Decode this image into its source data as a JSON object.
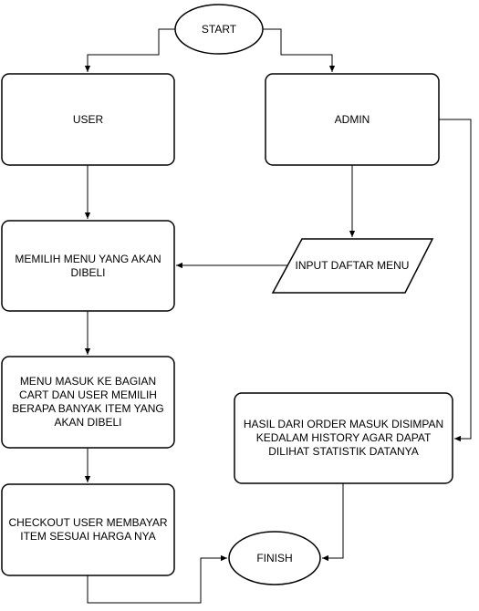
{
  "nodes": {
    "start": "START",
    "user": "USER",
    "admin": "ADMIN",
    "memilih_menu": "MEMILIH MENU YANG AKAN DIBELI",
    "input_menu": "INPUT DAFTAR MENU",
    "cart": "MENU MASUK KE BAGIAN CART DAN USER MEMILIH BERAPA BANYAK ITEM YANG AKAN DIBELI",
    "history": "HASIL DARI ORDER MASUK DISIMPAN KEDALAM HISTORY AGAR DAPAT DILIHAT STATISTIK DATANYA",
    "checkout": "CHECKOUT USER MEMBAYAR ITEM SESUAI HARGA NYA",
    "finish": "FINISH"
  }
}
